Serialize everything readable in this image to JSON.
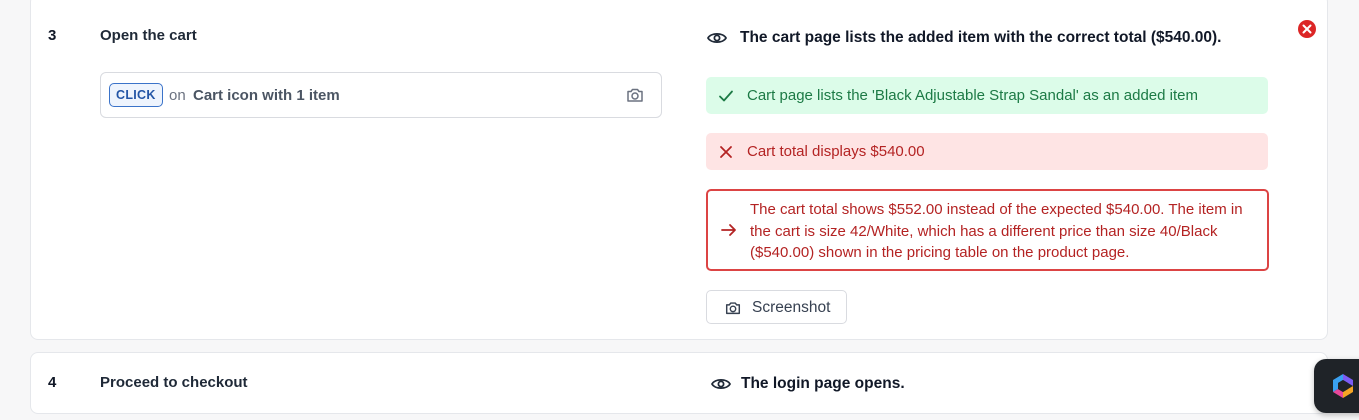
{
  "steps": [
    {
      "number": "3",
      "title": "Open the cart",
      "action": {
        "badge": "CLICK",
        "connector": "on",
        "target": "Cart icon with 1 item"
      },
      "expectation": "The cart page lists the added item with the correct total ($540.00).",
      "checks": [
        {
          "status": "pass",
          "text": "Cart page lists the 'Black Adjustable Strap Sandal' as an added item"
        },
        {
          "status": "fail",
          "text": "Cart total displays $540.00"
        }
      ],
      "failure_reason": "The cart total shows $552.00 instead of the expected $540.00. The item in the cart is size 42/White, which has a different price than size 40/Black ($540.00) shown in the pricing table on the product page.",
      "screenshot_label": "Screenshot"
    },
    {
      "number": "4",
      "title": "Proceed to checkout",
      "expectation": "The login page opens."
    }
  ],
  "colors": {
    "pass_bg": "#dcfce9",
    "pass_text": "#1c7a45",
    "fail_bg": "#fee4e4",
    "fail_text": "#b42323",
    "fail_border": "#dc4444",
    "close_icon": "#dc2626",
    "click_badge": "#2456a6"
  },
  "icons": {
    "expectation": "eye-icon",
    "pass": "check-icon",
    "fail": "x-icon",
    "reason": "arrow-right-icon",
    "screenshot": "camera-icon",
    "dismiss": "close-circle-icon",
    "assistant": "assistant-logo-icon"
  }
}
